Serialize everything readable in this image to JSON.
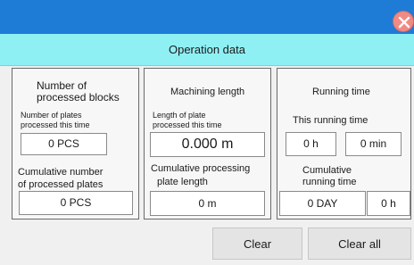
{
  "header": {
    "title": "Operation data"
  },
  "panels": {
    "blocks": {
      "title_line1": "Number of",
      "title_line2": "processed blocks",
      "plates_label_line1": "Number of plates",
      "plates_label_line2": "processed this time",
      "plates_value": "0 PCS",
      "cumulative_label_line1": "Cumulative number",
      "cumulative_label_line2": "of processed plates",
      "cumulative_value": "0 PCS"
    },
    "machining": {
      "title": "Machining length",
      "length_label_line1": "Length of plate",
      "length_label_line2": "processed this time",
      "length_value": "0.000 m",
      "cumulative_label_line1": "Cumulative processing",
      "cumulative_label_line2": "plate length",
      "cumulative_value": "0 m"
    },
    "running": {
      "title": "Running time",
      "this_label": "This running time",
      "hours_value": "0 h",
      "minutes_value": "0 min",
      "cumulative_label_line1": "Cumulative",
      "cumulative_label_line2": "running time",
      "days_value": "0 DAY",
      "cum_hours_value": "0 h"
    }
  },
  "buttons": {
    "clear": "Clear",
    "clear_all": "Clear all"
  }
}
